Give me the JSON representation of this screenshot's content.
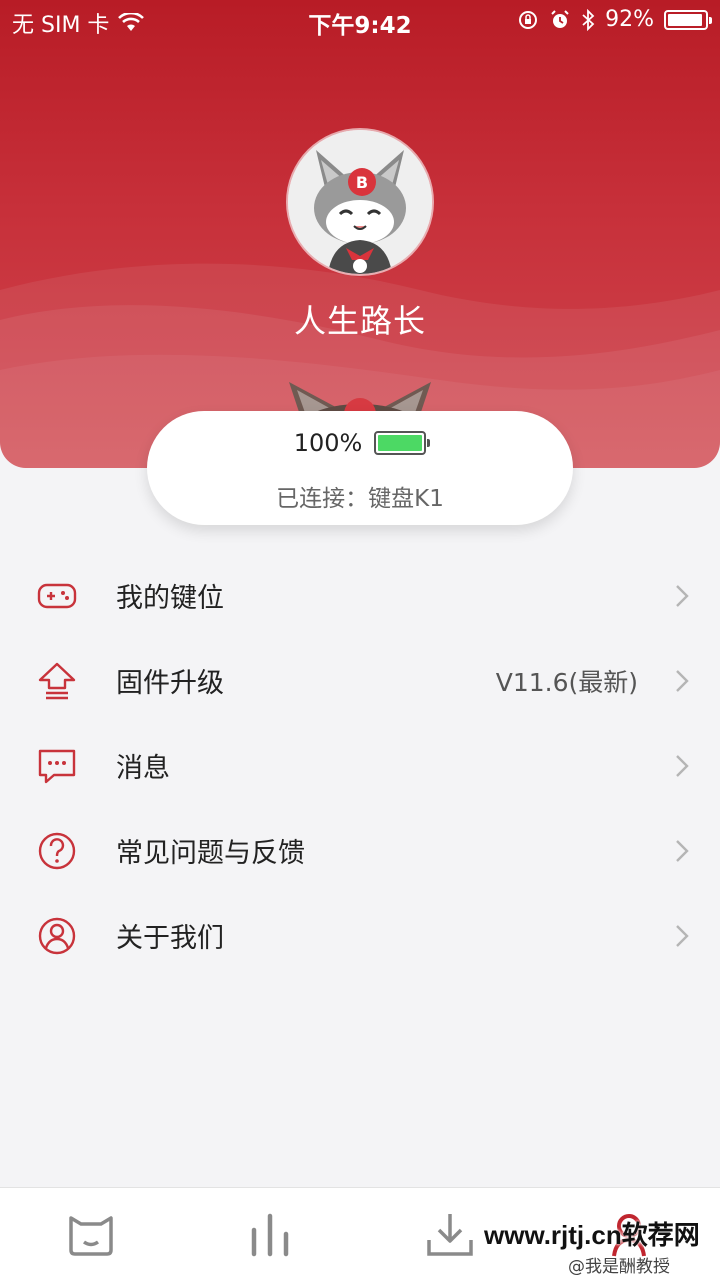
{
  "status_bar": {
    "carrier": "无 SIM 卡",
    "time": "下午9:42",
    "battery": "92%"
  },
  "profile": {
    "username": "人生路长"
  },
  "device": {
    "battery": "100%",
    "connected": "已连接：键盘K1"
  },
  "menu": {
    "items": [
      {
        "label": "我的键位",
        "value": "",
        "icon": "gamepad-icon"
      },
      {
        "label": "固件升级",
        "value": "V11.6(最新)",
        "icon": "upgrade-icon"
      },
      {
        "label": "消息",
        "value": "",
        "icon": "message-icon"
      },
      {
        "label": "常见问题与反馈",
        "value": "",
        "icon": "question-icon"
      },
      {
        "label": "关于我们",
        "value": "",
        "icon": "user-circle-icon"
      }
    ]
  },
  "tab_bar": {
    "tabs": [
      "cat-face-icon",
      "bar-chart-icon",
      "download-icon",
      "profile-icon"
    ]
  },
  "watermark": {
    "site": "www.rjtj.cn软荐网",
    "credit": "@我是酬教授"
  },
  "colors": {
    "accent": "#c0262f",
    "icon_red": "#c8333b",
    "tab_gray": "#8a8a8a",
    "battery_green": "#4cd964"
  }
}
